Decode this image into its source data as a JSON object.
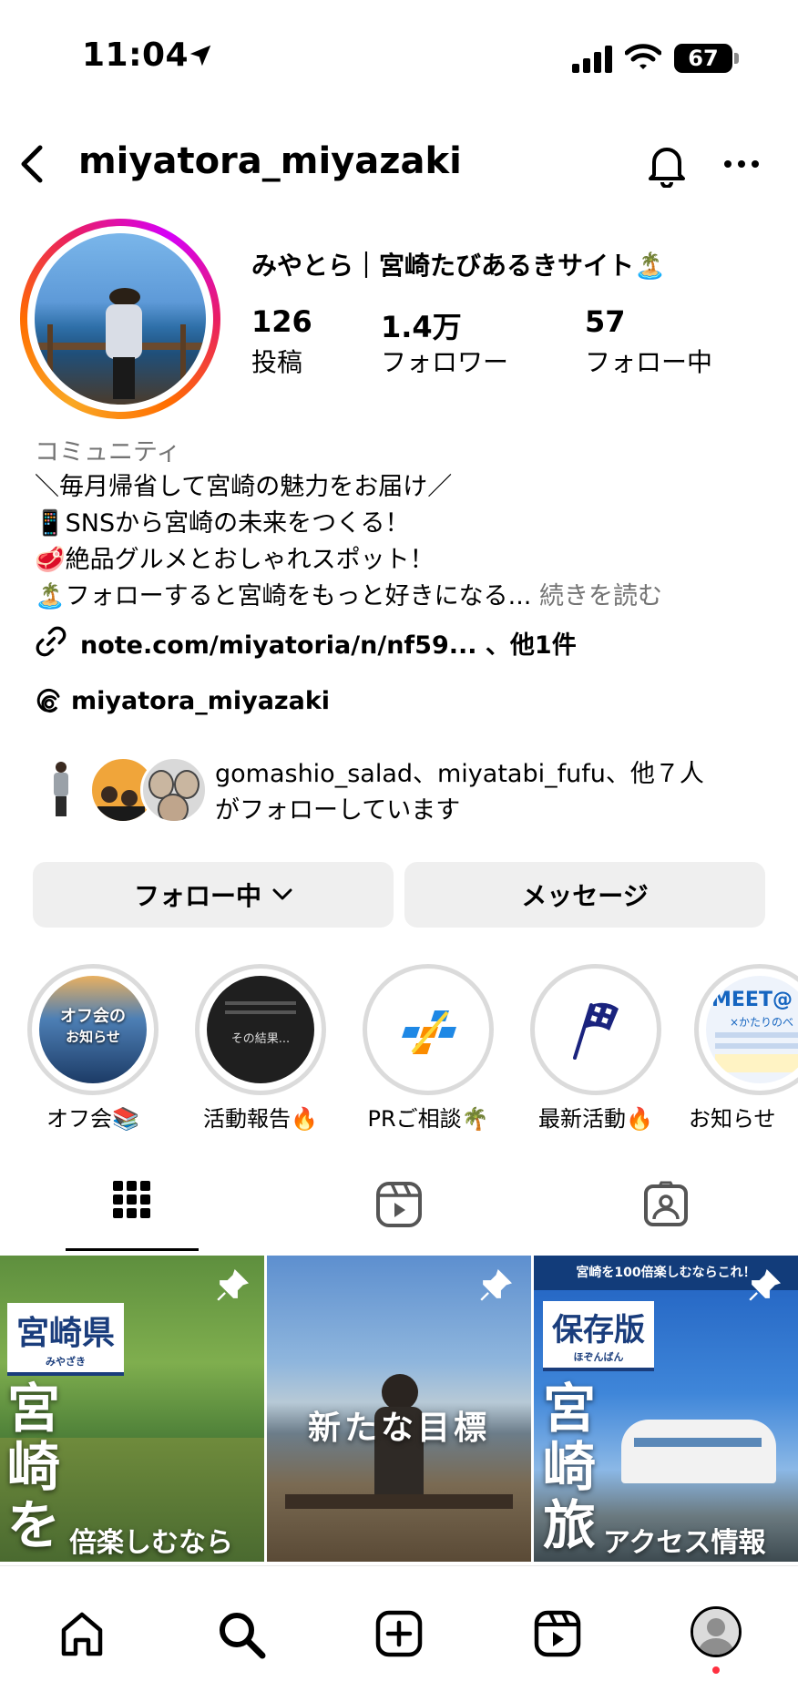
{
  "status_bar": {
    "time": "11:04",
    "battery": "67"
  },
  "header": {
    "username": "miyatora_miyazaki"
  },
  "profile": {
    "display_name": "みやとら｜宮崎たびあるきサイト🏝️",
    "stats": [
      {
        "value": "126",
        "label": "投稿"
      },
      {
        "value": "1.4万",
        "label": "フォロワー"
      },
      {
        "value": "57",
        "label": "フォロー中"
      }
    ],
    "category": "コミュニティ",
    "bio_lines": [
      "＼毎月帰省して宮崎の魅力をお届け／",
      "📱SNSから宮崎の未来をつくる！",
      "🥩絶品グルメとおしゃれスポット！",
      "🏝️フォローすると宮崎をもっと好きになる..."
    ],
    "read_more": "続きを読む",
    "link": "note.com/miyatoria/n/nf59... 、他1件",
    "threads_handle": "miyatora_miyazaki",
    "followed_by_line1": "gomashio_salad、miyatabi_fufu、他７人",
    "followed_by_line2": "がフォローしています"
  },
  "buttons": {
    "following": "フォロー中",
    "message": "メッセージ"
  },
  "highlights": [
    {
      "label": "オフ会📚",
      "cover_text_1": "オフ会の",
      "cover_text_2": "お知らせ"
    },
    {
      "label": "活動報告🔥",
      "cover_text": "その結果..."
    },
    {
      "label": "PRご相談🌴"
    },
    {
      "label": "最新活動🔥"
    },
    {
      "label": "お知らせ",
      "cover_text": "MEET@",
      "cover_sub": "×かたりのべ"
    }
  ],
  "posts": [
    {
      "tag": "宮崎県",
      "tag_sub": "みやざき",
      "big_1": "宮",
      "big_2": "崎",
      "big_3": "を",
      "sub": "倍楽しむなら"
    },
    {
      "center": "新たな目標"
    },
    {
      "top_banner": "宮崎を100倍楽しむならこれ！",
      "tag": "保存版",
      "tag_sub": "ほぞんばん",
      "big_1": "宮",
      "big_2": "崎",
      "big_3": "旅",
      "sub": "アクセス情報"
    }
  ],
  "colors": {
    "accent_red": "#ff3040",
    "gray_text": "#737373",
    "button_bg": "#efefef"
  }
}
